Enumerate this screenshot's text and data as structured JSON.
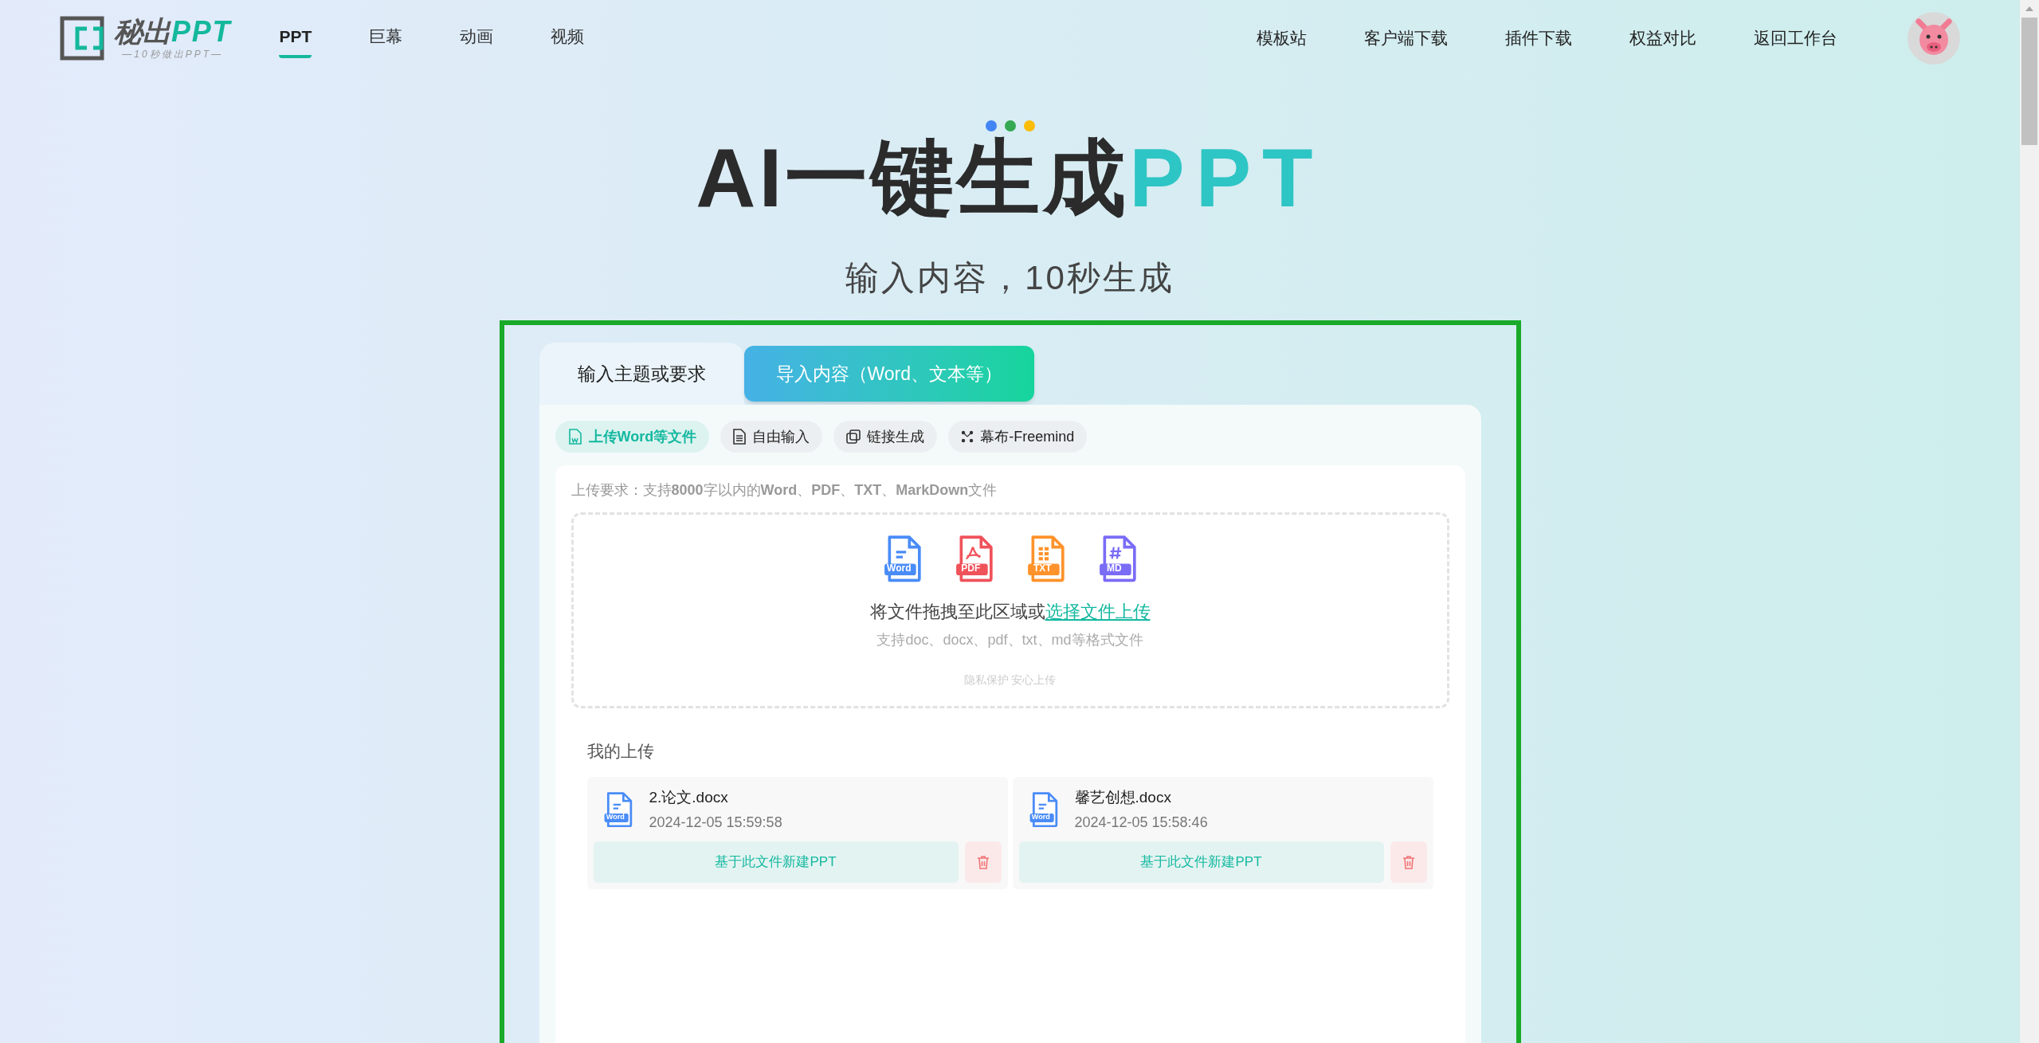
{
  "logo": {
    "name": "秘出",
    "brand": "PPT",
    "tagline": "—10秒做出PPT—"
  },
  "nav_left": [
    {
      "label": "PPT",
      "selected": true
    },
    {
      "label": "巨幕",
      "selected": false
    },
    {
      "label": "动画",
      "selected": false
    },
    {
      "label": "视频",
      "selected": false
    }
  ],
  "nav_right": [
    "模板站",
    "客户端下载",
    "插件下载",
    "权益对比",
    "返回工作台"
  ],
  "hero": {
    "dots": [
      {
        "color": "#4285f4"
      },
      {
        "color": "#34a853"
      },
      {
        "color": "#fbbc05"
      }
    ],
    "title": "AI一键生成",
    "title_accent": "PPT",
    "subtitle": "输入内容，10秒生成"
  },
  "tabs": [
    {
      "label": "输入主题或要求",
      "selected": false
    },
    {
      "label": "导入内容（Word、文本等）",
      "selected": true
    }
  ],
  "modes": [
    {
      "label": "上传Word等文件",
      "kind": "upload",
      "selected": true
    },
    {
      "label": "自由输入",
      "kind": "text",
      "selected": false
    },
    {
      "label": "链接生成",
      "kind": "link",
      "selected": false
    },
    {
      "label": "幕布-Freemind",
      "kind": "mindmap",
      "selected": false
    }
  ],
  "requirement": "上传要求：支持**8000**字以内的**Word**、**PDF**、**TXT**、**MarkDown**文件",
  "dropzone": {
    "formats": [
      {
        "label": "Word",
        "color": "#4a8cf7",
        "kind": "word"
      },
      {
        "label": "PDF",
        "color": "#f0525a",
        "kind": "pdf"
      },
      {
        "label": "TXT",
        "color": "#ff922b",
        "kind": "txt"
      },
      {
        "label": "MD",
        "color": "#7b6cf6",
        "kind": "md"
      }
    ],
    "prompt": "将文件拖拽至此区域或",
    "link": "选择文件上传",
    "hint": "支持doc、docx、pdf、txt、md等格式文件",
    "privacy": "隐私保护 安心上传"
  },
  "uploads": {
    "title": "我的上传",
    "items": [
      {
        "icon_label": "Word",
        "name": "2.论文.docx",
        "time": "2024-12-05 15:59:58",
        "action": "基于此文件新建PPT"
      },
      {
        "icon_label": "Word",
        "name": "馨艺创想.docx",
        "time": "2024-12-05 15:58:46",
        "action": "基于此文件新建PPT"
      }
    ]
  }
}
